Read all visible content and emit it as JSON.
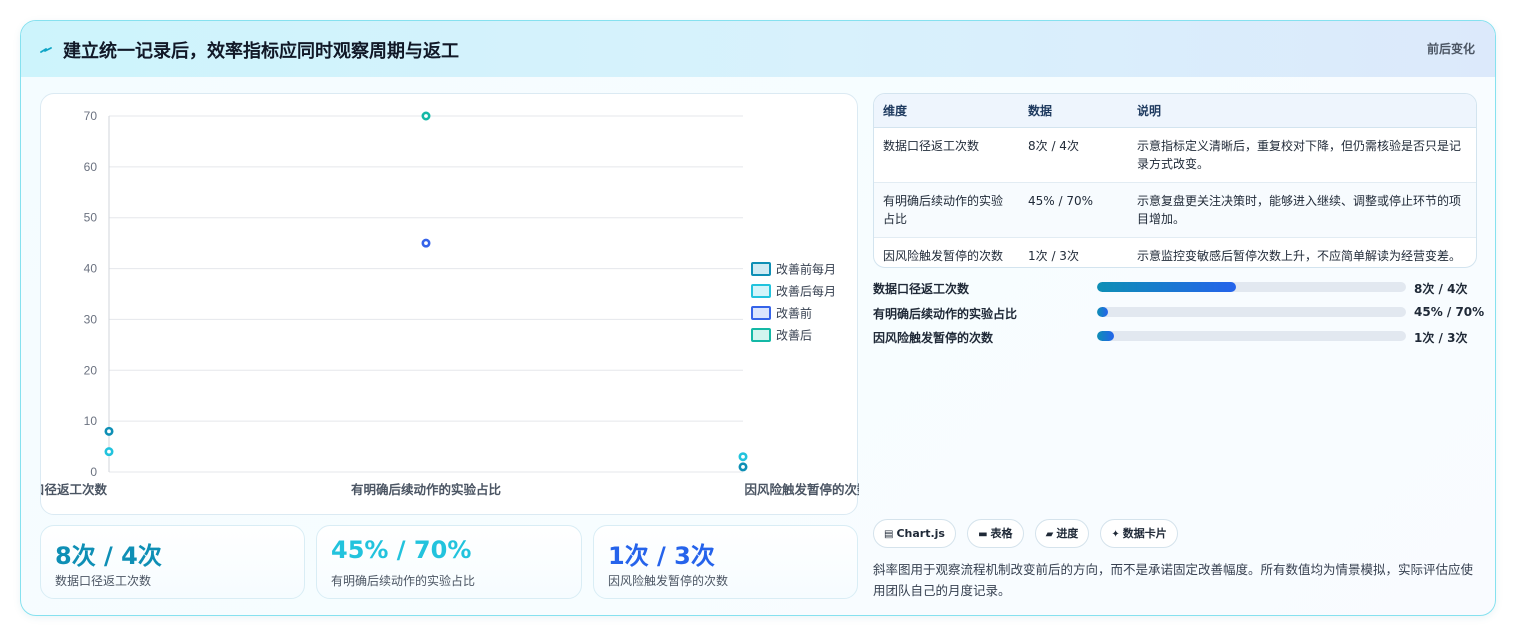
{
  "header": {
    "icon": "lightning-icon",
    "title": "建立统一记录后，效率指标应同时观察周期与返工",
    "right_label": "前后变化"
  },
  "colors": {
    "series_before_monthly": "#0e8fb5",
    "series_after_monthly": "#22c3dd",
    "series_before": "#3563e9",
    "series_after": "#14b8a6",
    "kpi1": "#0e8fb5",
    "kpi2": "#22c3dd",
    "kpi3": "#2563eb"
  },
  "chart_data": {
    "type": "scatter",
    "categories": [
      "数据口径返工次数",
      "有明确后续动作的实验占比",
      "因风险触发暂停的次数"
    ],
    "ylim": [
      0,
      70
    ],
    "y_ticks": [
      0,
      10,
      20,
      30,
      40,
      50,
      60,
      70
    ],
    "grid": true,
    "legend_position": "right",
    "series": [
      {
        "name": "改善前每月",
        "values": [
          8,
          null,
          1
        ]
      },
      {
        "name": "改善后每月",
        "values": [
          4,
          null,
          3
        ]
      },
      {
        "name": "改善前",
        "values": [
          null,
          45,
          null
        ]
      },
      {
        "name": "改善后",
        "values": [
          null,
          70,
          null
        ]
      }
    ]
  },
  "kpis": [
    {
      "value": "8次 / 4次",
      "label": "数据口径返工次数"
    },
    {
      "value": "45% / 70%",
      "label": "有明确后续动作的实验占比"
    },
    {
      "value": "1次 / 3次",
      "label": "因风险触发暂停的次数"
    }
  ],
  "table": {
    "headers": [
      "维度",
      "数据",
      "说明"
    ],
    "rows": [
      {
        "dimension": "数据口径返工次数",
        "data": "8次 / 4次",
        "note": "示意指标定义清晰后，重复校对下降，但仍需核验是否只是记录方式改变。"
      },
      {
        "dimension": "有明确后续动作的实验占比",
        "data": "45% / 70%",
        "note": "示意复盘更关注决策时，能够进入继续、调整或停止环节的项目增加。"
      },
      {
        "dimension": "因风险触发暂停的次数",
        "data": "1次 / 3次",
        "note": "示意监控变敏感后暂停次数上升，不应简单解读为经营变差。"
      }
    ]
  },
  "progress": [
    {
      "label": "数据口径返工次数",
      "value": "8次 / 4次",
      "fraction": 0.45
    },
    {
      "label": "有明确后续动作的实验占比",
      "value": "45% / 70%",
      "fraction": 0.035
    },
    {
      "label": "因风险触发暂停的次数",
      "value": "1次 / 3次",
      "fraction": 0.055
    }
  ],
  "tags": [
    {
      "icon": "chart-icon",
      "glyph": "▤",
      "label": "Chart.js"
    },
    {
      "icon": "table-icon",
      "glyph": "▬",
      "label": "表格"
    },
    {
      "icon": "progress-icon",
      "glyph": "▰",
      "label": "进度"
    },
    {
      "icon": "sparkle-icon",
      "glyph": "✦",
      "label": "数据卡片"
    }
  ],
  "note": "斜率图用于观察流程机制改变前后的方向，而不是承诺固定改善幅度。所有数值均为情景模拟，实际评估应使用团队自己的月度记录。"
}
